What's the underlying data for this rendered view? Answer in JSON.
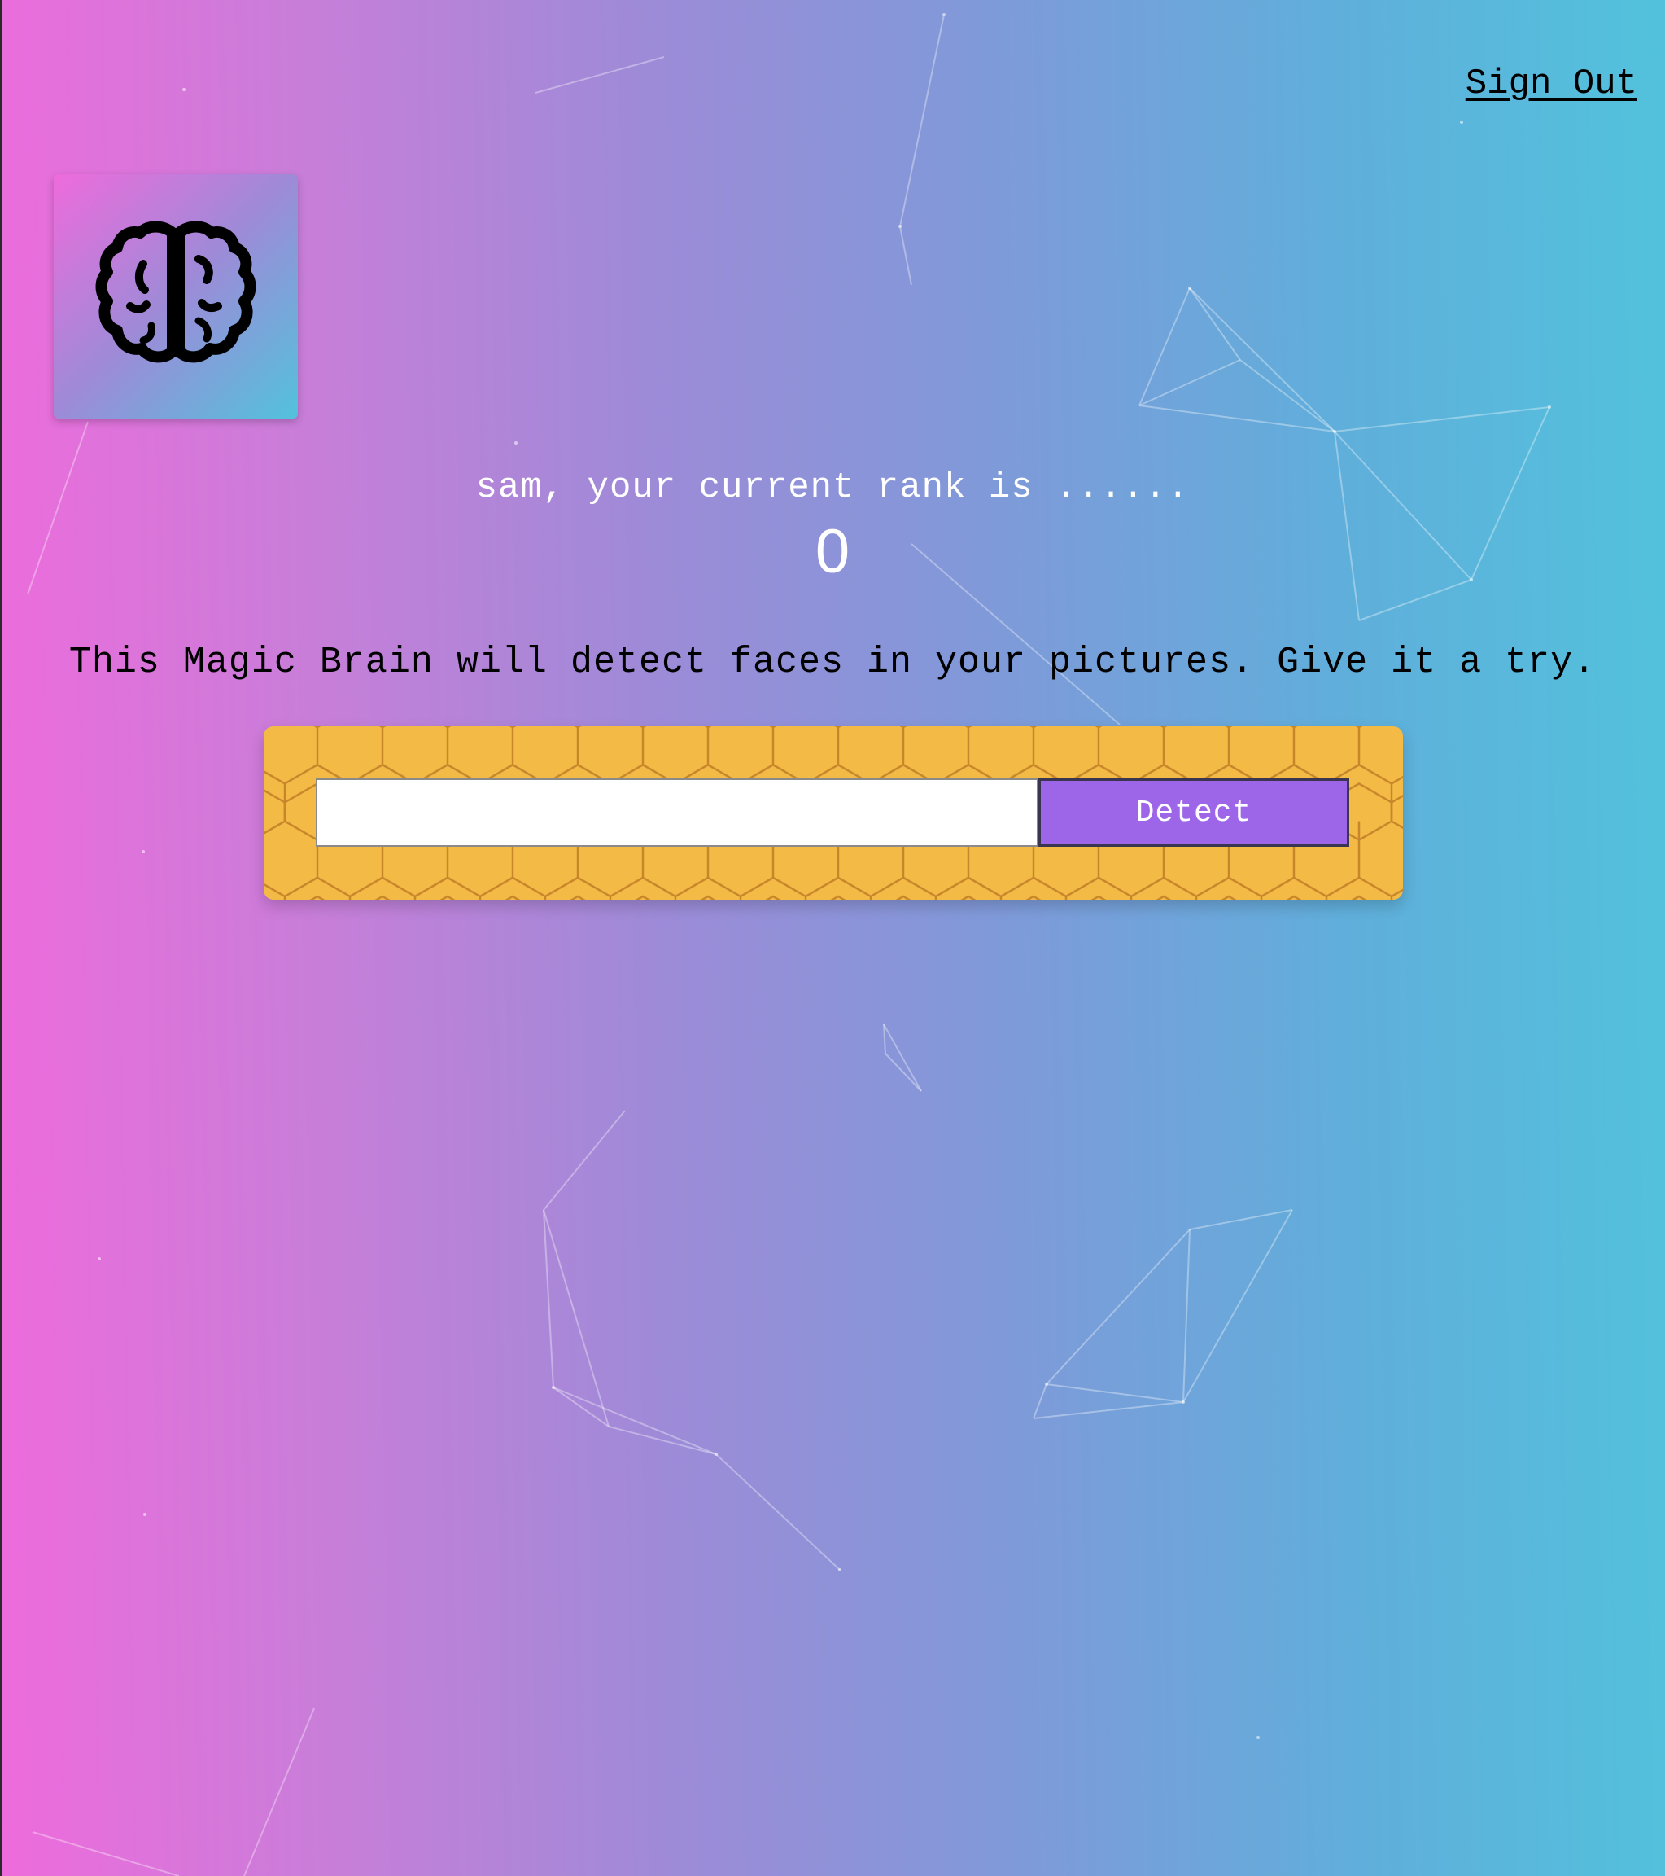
{
  "nav": {
    "signout_label": "Sign Out"
  },
  "logo": {
    "icon": "brain-icon"
  },
  "rank": {
    "message": "sam, your current rank is ......",
    "value": "0"
  },
  "intro": {
    "text": "This Magic Brain will detect faces in your pictures. Give it a try."
  },
  "form": {
    "url_value": "",
    "url_placeholder": "",
    "detect_label": "Detect"
  },
  "colors": {
    "gradient_start": "#ee6bdc",
    "gradient_end": "#52c2dc",
    "panel_yellow": "#f3bb45",
    "detect_purple": "#9d66e8"
  }
}
